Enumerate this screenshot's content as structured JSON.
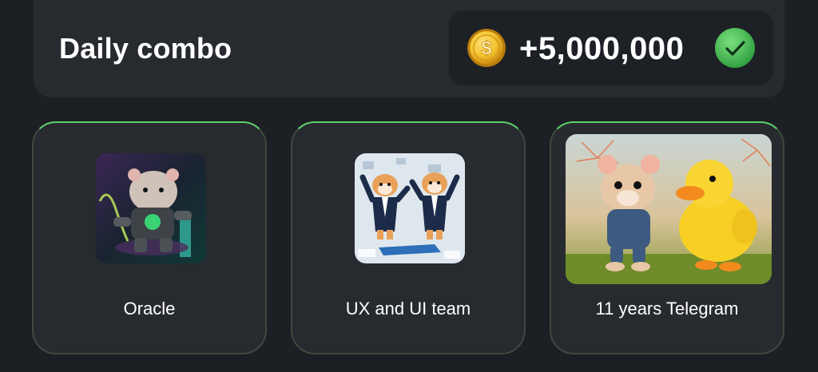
{
  "header": {
    "title": "Daily combo",
    "reward_amount": "+5,000,000",
    "coin_icon": "dollar-coin-icon",
    "status_icon": "checkmark-icon"
  },
  "cards": [
    {
      "label": "Oracle",
      "image": "hamster-cyborg-oracle"
    },
    {
      "label": "UX and UI team",
      "image": "hamsters-in-suits-dancing"
    },
    {
      "label": "11 years Telegram",
      "image": "hamster-and-duck-running"
    }
  ],
  "colors": {
    "background": "#1c1f24",
    "panel": "#272a2f",
    "accent_green": "#5fd16a",
    "coin_gold": "#f4c330",
    "text": "#ffffff"
  }
}
